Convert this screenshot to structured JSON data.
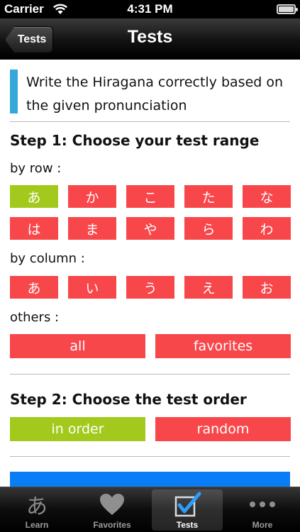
{
  "status_bar": {
    "carrier": "Carrier",
    "time": "4:31 PM"
  },
  "nav_bar": {
    "back_label": "Tests",
    "title": "Tests"
  },
  "instruction": "Write the Hiragana correctly based on the given pronunciation",
  "step1": {
    "heading": "Step 1: Choose your test range",
    "by_row_label": "by row :",
    "rows": [
      [
        "あ",
        "か",
        "こ",
        "た",
        "な"
      ],
      [
        "は",
        "ま",
        "や",
        "ら",
        "わ"
      ]
    ],
    "by_column_label": "by column :",
    "columns": [
      "あ",
      "い",
      "う",
      "え",
      "お"
    ],
    "others_label": "others :",
    "all_label": "all",
    "favorites_label": "favorites",
    "selected": "あ"
  },
  "step2": {
    "heading": "Step 2: Choose the test order",
    "in_order_label": "in order",
    "random_label": "random",
    "selected": "in order"
  },
  "colors": {
    "button_red": "#f8474b",
    "selected_green": "#a3c91d",
    "instruction_accent": "#34a8d8",
    "start_blue": "#0a7cf5"
  },
  "tab_bar": {
    "tabs": [
      {
        "label": "Learn",
        "icon": "hiragana-a-icon",
        "glyph": "あ"
      },
      {
        "label": "Favorites",
        "icon": "heart-icon"
      },
      {
        "label": "Tests",
        "icon": "checkbox-icon",
        "active": true
      },
      {
        "label": "More",
        "icon": "more-dots-icon"
      }
    ]
  }
}
